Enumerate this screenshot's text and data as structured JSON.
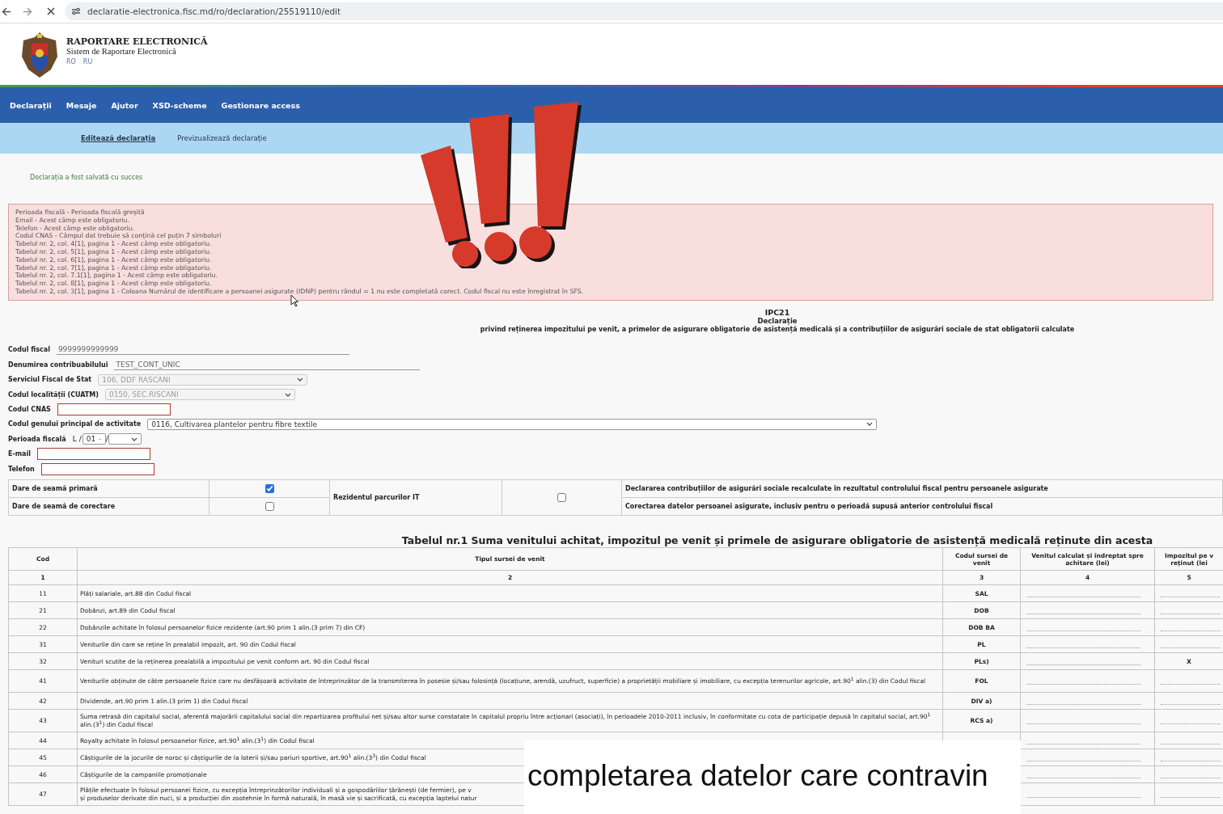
{
  "browser": {
    "url": "declaratie-electronica.fisc.md/ro/declaration/25519110/edit",
    "loading": true
  },
  "header": {
    "title": "RAPORTARE ELECTRONICĂ",
    "subtitle": "Sistem de Raportare Electronică",
    "languages": [
      "RO",
      "RU"
    ]
  },
  "nav": [
    "Declarații",
    "Mesaje",
    "Ajutor",
    "XSD-scheme",
    "Gestionare access"
  ],
  "subnav": [
    {
      "label": "Editează declarația",
      "selected": true
    },
    {
      "label": "Previzualizează declarație",
      "selected": false
    }
  ],
  "success_message": "Declarația a fost salvată cu succes",
  "errors": [
    "Perioada fiscală - Perioada fiscală greșită",
    "Email - Acest câmp este obligatoriu.",
    "Telefon - Acest câmp este obligatoriu.",
    "Codul CNAS - Câmpul dat trebuie să conțină cel puțin 7 simboluri",
    "Tabelul nr. 2, col. 4[1], pagina 1 - Acest câmp este obligatoriu.",
    "Tabelul nr. 2, col. 5[1], pagina 1 - Acest câmp este obligatoriu.",
    "Tabelul nr. 2, col. 6[1], pagina 1 - Acest câmp este obligatoriu.",
    "Tabelul nr. 2, col. 7[1], pagina 1 - Acest câmp este obligatoriu.",
    "Tabelul nr. 2, col. 7.1[1], pagina 1 - Acest câmp este obligatoriu.",
    "Tabelul nr. 2, col. 8[1], pagina 1 - Acest câmp este obligatoriu.",
    "Tabelul nr. 2, col. 3[1], pagina 1 - Coloana Numărul de identificare a persoanei asigurate (IDNP) pentru rândul = 1 nu este completată corect. Codul fiscal nu este înregistrat în SFS."
  ],
  "form_title": {
    "code": "IPC21",
    "title": "Declarație",
    "subtitle": "privind reținerea impozitului pe venit, a primelor de asigurare obligatorie de asistență medicală și a contribuțiilor de asigurări sociale de stat obligatorii calculate"
  },
  "fields": [
    {
      "kind": "text",
      "label": "Codul fiscal",
      "value": "9999999999999"
    },
    {
      "kind": "text",
      "label": "Denumirea contribuabilului",
      "value": "TEST_CONT_UNIC"
    },
    {
      "kind": "select",
      "label": "Serviciul Fiscal de Stat",
      "value": "106, DDF RASCANI",
      "disabled": true
    },
    {
      "kind": "select",
      "label": "Codul localității (CUATM)",
      "value": "0150, SEC.RISCANI",
      "disabled": true
    },
    {
      "kind": "input",
      "label": "Codul CNAS",
      "error": true
    },
    {
      "kind": "select",
      "label": "Codul genului principal de activitate",
      "value": "0116, Cultivarea plantelor pentru fibre textile",
      "disabled": false
    },
    {
      "kind": "period",
      "label": "Perioada fiscală",
      "prefix": "L /",
      "month": "01",
      "separator": "/"
    },
    {
      "kind": "input",
      "label": "E-mail",
      "error": true
    },
    {
      "kind": "input",
      "label": "Telefon",
      "error": true
    }
  ],
  "report_type": {
    "rows": [
      {
        "label": "Dare de seamă primară",
        "checked": true
      },
      {
        "label": "Dare de seamă de corectare",
        "checked": false
      }
    ],
    "it_resident": {
      "label": "Rezidentul parcurilor IT",
      "checked": false
    },
    "notes": [
      "Declararea contribuțiilor de asigurări sociale recalculate în rezultatul controlului fiscal pentru persoanele asigurate",
      "Corectarea datelor persoanei asigurate, inclusiv pentru o perioadă supusă anterior controlului fiscal"
    ]
  },
  "table1": {
    "title": "Tabelul nr.1 Suma venitului achitat, impozitul pe venit și primele de asigurare obligatorie de asistență medicală reținute din acesta",
    "columns": [
      {
        "label": "Cod",
        "number": "1"
      },
      {
        "label": "Tipul sursei de venit",
        "number": "2"
      },
      {
        "label": "Codul sursei de venit",
        "number": "3"
      },
      {
        "label": "Venitul calculat și îndreptat spre achitare (lei)",
        "number": "4"
      },
      {
        "label": "Impozitul pe v reținut (lei",
        "number": "5"
      }
    ],
    "rows": [
      {
        "code": "11",
        "text": "Plăți salariale, art.88 din Codul fiscal",
        "source": "SAL"
      },
      {
        "code": "21",
        "text": "Dobânzi, art.89 din Codul fiscal",
        "source": "DOB"
      },
      {
        "code": "22",
        "text": "Dobânzile achitate în folosul persoanelor fizice rezidente (art.90 prim 1 alin.(3 prim 7) din CF)",
        "source": "DOB BA"
      },
      {
        "code": "31",
        "text": "Veniturile din care se reține în prealabil impozit, art. 90 din Codul fiscal",
        "source": "PL"
      },
      {
        "code": "32",
        "text": "Venituri scutite de la reținerea prealabilă a impozitului pe venit conform art. 90 din Codul fiscal",
        "source": "PLs)",
        "tax": "X"
      },
      {
        "code": "41",
        "text": "Veniturile obținute de către persoanele fizice care nu desfășoară activitate de întreprinzător de la transmiterea în posesie și/sau folosință (locațiune, arendă, uzufruct, superficie) a proprietății mobiliare și imobiliare, cu excepția terenurilor agricole, art.90$^{1}$ alin.(3) din Codul fiscal",
        "source": "FOL"
      },
      {
        "code": "42",
        "text": "Dividende, art.90 prim 1 alin.(3 prim 1) din Codul fiscal",
        "source": "DIV a)"
      },
      {
        "code": "43",
        "text": "Suma retrasă din capitalul social, aferentă majorării capitalului social din repartizarea profitului net și/sau altor surse constatate în capitalul propriu între acționari (asociați), în perioadele 2010-2011 inclusiv, în conformitate cu cota de participație depusă în capitalul social, art.90$^{1}$ alin.(3$^{1}$) din Codul fiscal",
        "source": "RCS a)"
      },
      {
        "code": "44",
        "text": "Royalty achitate în folosul persoanelor fizice, art.90$^{1}$ alin.(3$^{1}$) din Codul fiscal"
      },
      {
        "code": "45",
        "text": "Câștigurile de la jocurile de noroc și câștigurile de la loterii și/sau pariuri sportive, art.90$^{1}$ alin.(3$^{3}$) din Codul fiscal"
      },
      {
        "code": "46",
        "text": "Câștigurile de la campaniile promoționale"
      },
      {
        "code": "47",
        "lines": [
          "Plățile efectuate în folosul persoanei fizice, cu excepția întreprinzătorilor individuali și a gospodăriilor țărănești (de fermier), pe v",
          "și produselor derivate din nuci, și a producției din zootehnie în formă naturală, în masă vie și sacrificată, cu excepția laptelui natur"
        ]
      }
    ]
  },
  "caption": "completarea datelor care contravin"
}
